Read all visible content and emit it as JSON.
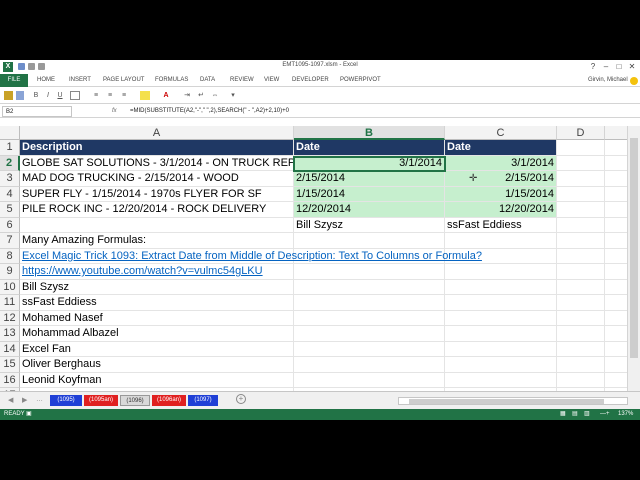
{
  "window": {
    "title": "EMT1095-1097.xlsm - Excel",
    "controls": [
      "?",
      "–",
      "□",
      "✕"
    ]
  },
  "ribbon": {
    "file_label": "FILE",
    "tabs": [
      "HOME",
      "INSERT",
      "PAGE LAYOUT",
      "FORMULAS",
      "DATA",
      "REVIEW",
      "VIEW",
      "DEVELOPER",
      "POWERPIVOT"
    ],
    "user": "Girvin, Michael"
  },
  "formula_bar": {
    "name_box": "B2",
    "fx_label": "fx",
    "formula": "=MID(SUBSTITUTE(A2,\"-\",\" \",2),SEARCH(\" - \",A2)+2,10)+0"
  },
  "columns": [
    "A",
    "B",
    "C",
    "D"
  ],
  "rows": [
    "1",
    "2",
    "3",
    "4",
    "5",
    "6",
    "7",
    "8",
    "9",
    "10",
    "11",
    "12",
    "13",
    "14",
    "15",
    "16",
    "17"
  ],
  "cells": {
    "A1": "Description",
    "B1": "Date",
    "C1": "Date",
    "A2": "GLOBE SAT SOLUTIONS - 3/1/2014 - ON TRUCK REPORT",
    "B2": "3/1/2014",
    "C2": "3/1/2014",
    "A3": "MAD DOG TRUCKING - 2/15/2014 - WOOD",
    "B3": "2/15/2014",
    "C3": "2/15/2014",
    "A4": "SUPER FLY - 1/15/2014 - 1970s FLYER FOR SF",
    "B4": "1/15/2014",
    "C4": "1/15/2014",
    "A5": "PILE ROCK INC - 12/20/2014 - ROCK DELIVERY",
    "B5": "12/20/2014",
    "C5": "12/20/2014",
    "B6": "Bill Szysz",
    "C6": "ssFast Eddiess",
    "A7": "Many Amazing Formulas:",
    "A8": "Excel Magic Trick 1093: Extract Date from Middle of Description: Text To Columns or Formula?",
    "A9": "https://www.youtube.com/watch?v=vulmc54gLKU",
    "A10": "Bill Szysz",
    "A11": "ssFast Eddiess",
    "A12": "Mohamed Nasef",
    "A13": "Mohammad Albazel",
    "A14": "Excel Fan",
    "A15": "Oliver Berghaus",
    "A16": "Leonid Koyfman",
    "A17": ""
  },
  "sheet_tabs": [
    {
      "label": "(1095)",
      "color": "#1f3fd6",
      "active": false
    },
    {
      "label": "(1095an)",
      "color": "#e02020",
      "active": false
    },
    {
      "label": "(1096)",
      "color": "#d9d9d9",
      "active": true
    },
    {
      "label": "(1096an)",
      "color": "#e02020",
      "active": false
    },
    {
      "label": "(1097)",
      "color": "#1f3fd6",
      "active": false
    }
  ],
  "status": {
    "mode": "READY",
    "zoom": "137%"
  },
  "colors": {
    "excel_green": "#217346",
    "header_fill": "#1f3864",
    "green_fill": "#c6efce",
    "link": "#0563c1"
  }
}
